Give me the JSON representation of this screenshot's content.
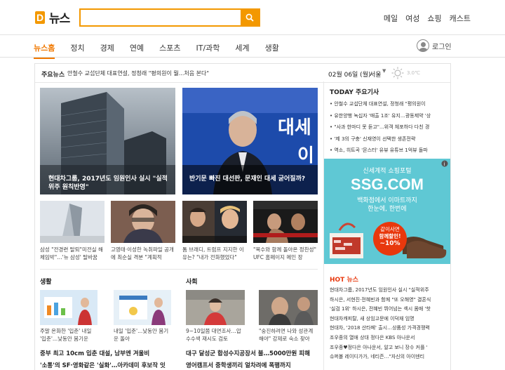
{
  "header": {
    "logo_letter": "D",
    "logo_text": "뉴스",
    "search_value": "",
    "nav": [
      "메일",
      "여성",
      "쇼핑",
      "캐스트"
    ]
  },
  "gnb": {
    "items": [
      "뉴스홈",
      "정치",
      "경제",
      "연예",
      "스포츠",
      "IT/과학",
      "세계",
      "생활"
    ],
    "active": "뉴스홈",
    "login": "로그인"
  },
  "ticker": {
    "label": "주요뉴스",
    "text": "안철수 교섭단체 대표연설, 정청래 \"평의원이 뭘...처음 본다\"",
    "date": "02월 06일 (월)",
    "city": "서울",
    "temp": "3.0℃"
  },
  "main": {
    "card1": "현대차그룹, 2017년도 임원인사 실시 \"실적위주 원칙반영\"",
    "card2": "반기문 빠진 대선판, 문재인 대세 굳어질까?",
    "card2_overlay_1": "대세",
    "card2_overlay_2": "이",
    "thumbs": [
      "삼성 \"전경련 탈퇴\"미전실 해체임박\"…'뉴 삼성' 탈바꿈",
      "고영태·이성한 녹취파일 공개에 최순실 격분 \"계획적",
      "톰 브래디, 트럼프 지지한 이유는? \"내가 전화했었다\"",
      "\"복수와 함께 돌아온 정찬성\" UFC 홈페이지 메인 장"
    ]
  },
  "sections": [
    {
      "title": "생활",
      "thumbs": [
        "주말 온화한 '입춘' 내일 '입춘'...낮동안 봄기운",
        "내일 '입춘'...낮동안 봄기운 돌아"
      ],
      "headlines": [
        "중부 최고 10cm 입춘 대설, 남부엔 겨울비",
        "'소통'의 SF·영화같은 '실화'…아카데미 후보작 잇"
      ]
    },
    {
      "title": "사회",
      "thumbs": [
        "9~10일쯤 대면조사…압수수색 재시도 검토",
        "\"숭진하려면 나와 성관계해야\" 강제로 숙소 찾아"
      ],
      "headlines": [
        "대구 달성군 합성수지공장서 불…5000만원 피해",
        "영어캠프서 중학생끼리 얼차려에 폭행까지"
      ]
    }
  ],
  "sidebar": {
    "title": "TODAY 주요기사",
    "items": [
      "안철수 교섭단체 대표연설, 정청래 \"평의원이",
      "유한양행 녹십자 '매출 1조' 유지…광동제약 '상",
      "\"사과 한마디 못 듣고\"...위객 체포하다 다친 경",
      "'제 3의 구충' 신재영이 선택한 생존전략",
      "역소, 히트곡 '몬스터' 유뷰 유튜브 1억뷰 돌파"
    ]
  },
  "ad": {
    "brand_top": "신세계적 쇼핑포털",
    "brand": "SSG.COM",
    "line1": "백화점에서 이마트까지",
    "line2": "한눈에, 한번에",
    "badge1": "같이사면",
    "badge2": "함께할인!",
    "badge3": "~10%",
    "color_bg": "#5fc8d4",
    "color_accent": "#e8380d"
  },
  "hot": {
    "title": "HOT 뉴스",
    "items": [
      "현대차그룹, 2017년도 임원인사 실시 \"실적위주",
      "하시은, 서현진·전혜빈과 함께 \"또 오해영\" 결혼식",
      "'실검 1위' 하시은, 전혜빈 뛰어넘는 섹시 몸매 '핫",
      "현대차캐피탈, 새 상임고문에 이덕재 임명",
      "현대차, '2018 산타페' 출시…상품성 가격경쟁력",
      "조우종의 열애 상대 정다은 KBS 아나운서",
      "조우종♥정다은 아나운서, 알고 보니 장수 커플 '",
      "슈퍼볼 레이디가가, 네티즌…\"자신의 아이덴티"
    ]
  }
}
